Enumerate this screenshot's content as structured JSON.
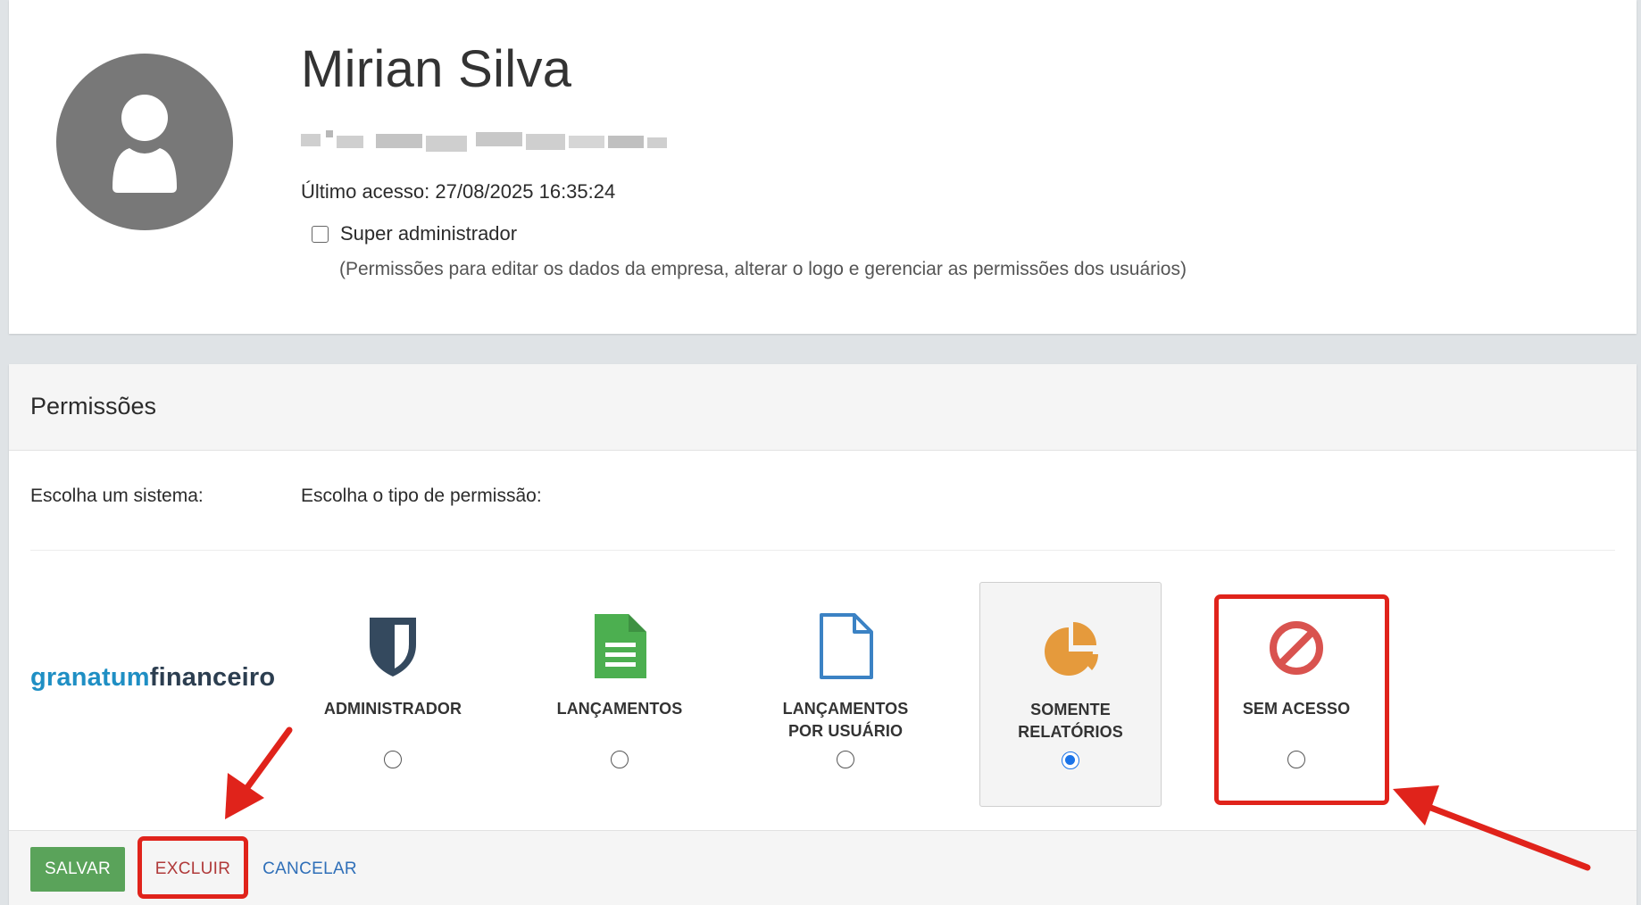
{
  "profile": {
    "name": "Mirian Silva",
    "email": "",
    "last_access": "Último acesso: 27/08/2025 16:35:24",
    "super_admin_label": "Super administrador",
    "super_admin_checked": false,
    "super_admin_description": "(Permissões para editar os dados da empresa, alterar o logo e gerenciar as permissões dos usuários)"
  },
  "permissions": {
    "title": "Permissões",
    "choose_system_label": "Escolha um sistema:",
    "choose_type_label": "Escolha o tipo de permissão:",
    "system_logo": {
      "part1": "granatum",
      "part2": "financeiro"
    },
    "options": [
      {
        "label": "ADMINISTRADOR",
        "icon": "shield-icon",
        "color": "#34495e",
        "selected": false
      },
      {
        "label": "LANÇAMENTOS",
        "icon": "document-text-icon",
        "color": "#4caf50",
        "selected": false
      },
      {
        "label": "LANÇAMENTOS POR USUÁRIO",
        "icon": "document-outline-icon",
        "color": "#3b82c4",
        "selected": false
      },
      {
        "label": "SOMENTE RELATÓRIOS",
        "icon": "pie-chart-icon",
        "color": "#e59a3c",
        "selected": true
      },
      {
        "label": "SEM ACESSO",
        "icon": "ban-icon",
        "color": "#d9534f",
        "selected": false
      }
    ]
  },
  "footer": {
    "save_label": "SALVAR",
    "delete_label": "EXCLUIR",
    "cancel_label": "CANCELAR"
  },
  "colors": {
    "save_button": "#5aa35a",
    "delete_text": "#b03a3a",
    "cancel_text": "#2f6fb8",
    "annotation_red": "#e0231b",
    "radio_selected": "#1a73e8"
  }
}
